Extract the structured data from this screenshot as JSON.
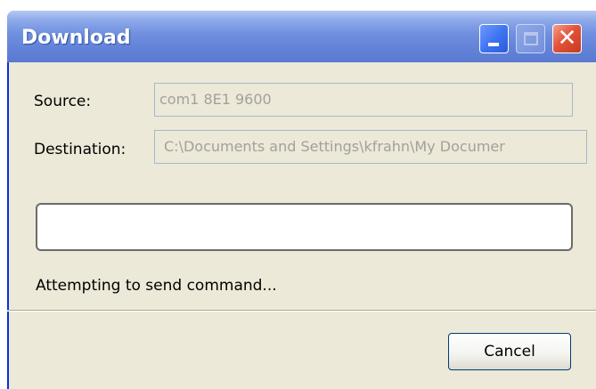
{
  "window": {
    "title": "Download",
    "controls": {
      "minimize_icon": "minimize-icon",
      "maximize_icon": "maximize-icon",
      "close_icon": "close-icon",
      "close_glyph": "✕"
    }
  },
  "form": {
    "source_label": "Source:",
    "source_value": "com1 8E1 9600",
    "destination_label": "Destination:",
    "destination_value": "C:\\Documents and Settings\\kfrahn\\My Documer"
  },
  "progress": {
    "fraction": 0
  },
  "status": {
    "text": "Attempting to send command..."
  },
  "buttons": {
    "cancel_label": "Cancel"
  },
  "colors": {
    "titlebar": "#6282d8",
    "window_bg": "#ece9d8",
    "close_button": "#e2533a",
    "progress_fill": "#4fc44b"
  }
}
